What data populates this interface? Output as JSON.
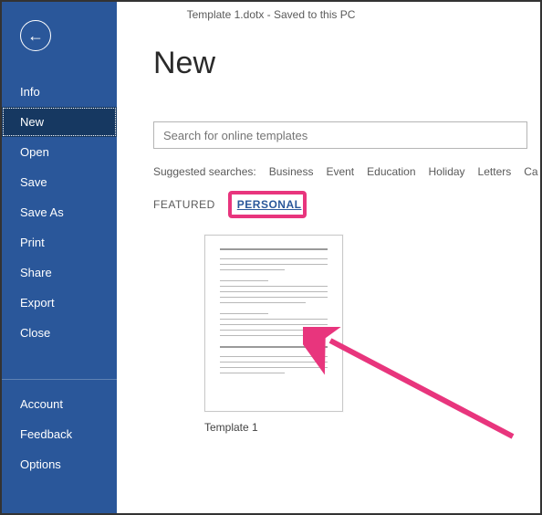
{
  "titlebar": {
    "text": "Template 1.dotx  -  Saved to this PC"
  },
  "back_icon": "←",
  "sidebar": {
    "items": [
      {
        "label": "Info"
      },
      {
        "label": "New",
        "active": true
      },
      {
        "label": "Open"
      },
      {
        "label": "Save"
      },
      {
        "label": "Save As"
      },
      {
        "label": "Print"
      },
      {
        "label": "Share"
      },
      {
        "label": "Export"
      },
      {
        "label": "Close"
      }
    ],
    "footer_items": [
      {
        "label": "Account"
      },
      {
        "label": "Feedback"
      },
      {
        "label": "Options"
      }
    ]
  },
  "main": {
    "title": "New",
    "search_placeholder": "Search for online templates",
    "suggested_label": "Suggested searches:",
    "suggested": [
      "Business",
      "Event",
      "Education",
      "Holiday",
      "Letters",
      "Ca"
    ],
    "tabs": {
      "featured": "FEATURED",
      "personal": "PERSONAL"
    },
    "template": {
      "name": "Template 1"
    }
  }
}
